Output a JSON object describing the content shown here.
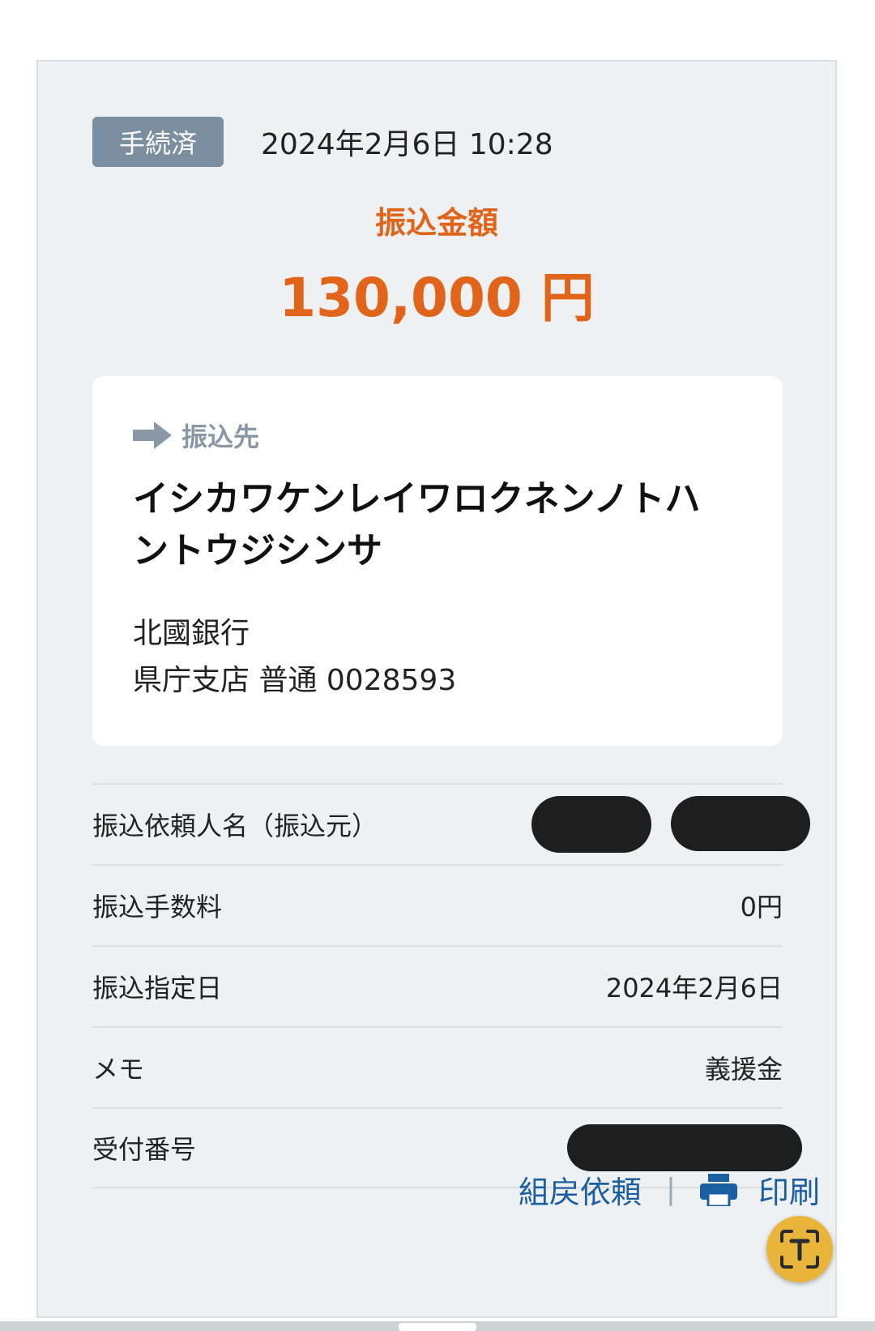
{
  "status": {
    "badge": "手続済",
    "timestamp": "2024年2月6日 10:28"
  },
  "amount": {
    "label": "振込金額",
    "value": "130,000 円"
  },
  "payee": {
    "heading": "振込先",
    "name": "イシカワケンレイワロクネンノトハントウジシンサ",
    "bank": "北國銀行",
    "account": "県庁支店 普通 0028593"
  },
  "details": {
    "sender_label": "振込依頼人名（振込元）",
    "fee_label": "振込手数料",
    "fee_value": "0円",
    "date_label": "振込指定日",
    "date_value": "2024年2月6日",
    "memo_label": "メモ",
    "memo_value": "義援金",
    "receipt_label": "受付番号"
  },
  "actions": {
    "cancel_request": "組戻依頼",
    "separator": "|",
    "print": "印刷"
  },
  "colors": {
    "accent_orange": "#e0651a",
    "badge_gray": "#7c8fa0",
    "link_blue": "#1a5fa0",
    "card_bg": "#eef0f2"
  },
  "icons": {
    "payee_heading": "arrow-right-icon",
    "print": "printer-icon",
    "lens": "text-scan-icon"
  }
}
